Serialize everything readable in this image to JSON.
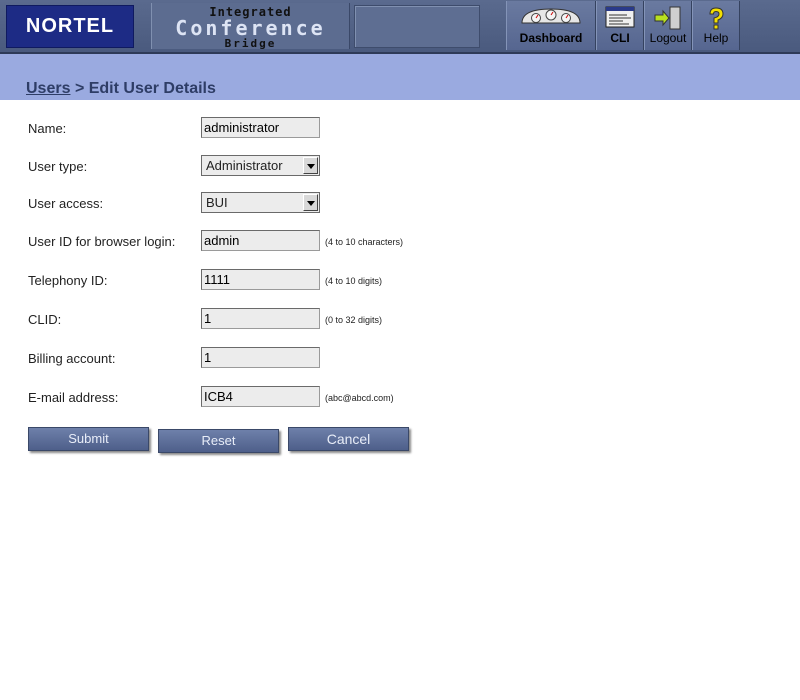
{
  "header": {
    "logo": "NORTEL",
    "product_line1": "Integrated",
    "product_line2": "Conference",
    "product_line3": "Bridge",
    "nav": {
      "dashboard": "Dashboard",
      "cli": "CLI",
      "logout": "Logout",
      "help": "Help"
    }
  },
  "breadcrumb": {
    "parent": "Users",
    "separator": ">",
    "current": "Edit User Details"
  },
  "form": {
    "name": {
      "label": "Name:",
      "value": "administrator"
    },
    "user_type": {
      "label": "User type:",
      "value": "Administrator"
    },
    "user_access": {
      "label": "User access:",
      "value": "BUI"
    },
    "user_id": {
      "label": "User ID for browser login:",
      "value": "admin",
      "hint": "(4 to 10 characters)"
    },
    "telephony_id": {
      "label": "Telephony ID:",
      "value": "1111",
      "hint": "(4 to 10 digits)"
    },
    "clid": {
      "label": "CLID:",
      "value": "1",
      "hint": "(0 to 32 digits)"
    },
    "billing": {
      "label": "Billing account:",
      "value": "1"
    },
    "email": {
      "label": "E-mail address:",
      "value": "ICB4",
      "hint": "(abc@abcd.com)"
    }
  },
  "buttons": {
    "submit": "Submit",
    "reset": "Reset",
    "cancel": "Cancel"
  },
  "colors": {
    "banner": "#4a5a7e",
    "logo_bg": "#1d2b85",
    "band": "#9aaae0",
    "button": "#5a6b96"
  }
}
